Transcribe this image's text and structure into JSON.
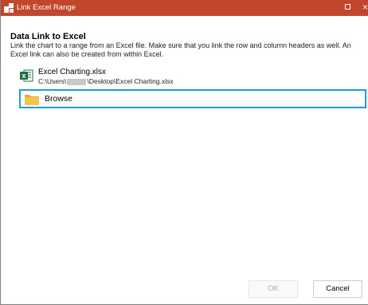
{
  "window": {
    "title": "Link Excel Range",
    "close_glyph": "×",
    "accent": "#c0472b"
  },
  "content": {
    "heading": "Data Link to Excel",
    "description": "Link the chart to a range from an Excel file. Make sure that you link the row and column headers as well. An Excel link can also be created from within Excel."
  },
  "recent_file": {
    "name": "Excel Charting.xlsx",
    "path_prefix": "C:\\Users\\",
    "path_suffix": "\\Desktop\\Excel Charting.xlsx",
    "icon": "excel-file-icon"
  },
  "browse": {
    "label": "Browse",
    "icon": "folder-icon",
    "focus_color": "#1ca0d0"
  },
  "buttons": {
    "ok": "OK",
    "cancel": "Cancel"
  }
}
